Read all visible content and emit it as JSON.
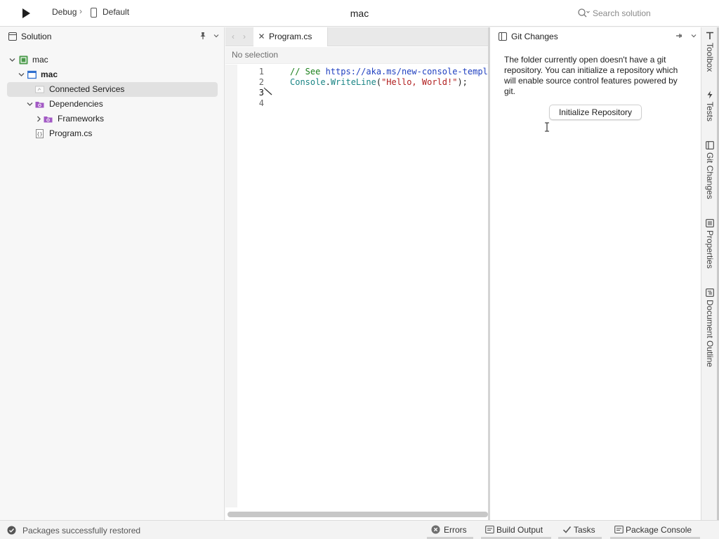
{
  "toolbar": {
    "run_icon": "play-icon",
    "configuration": "Debug",
    "separator": "›",
    "device": "Default",
    "window_title": "mac",
    "search_placeholder": "Search solution"
  },
  "solution_panel": {
    "title": "Solution",
    "tree": [
      {
        "label": "mac",
        "kind": "solution",
        "expanded": true
      },
      {
        "label": "mac",
        "kind": "project",
        "expanded": true
      },
      {
        "label": "Connected Services",
        "kind": "folder",
        "selected": true
      },
      {
        "label": "Dependencies",
        "kind": "dependencies",
        "expanded": true
      },
      {
        "label": "Frameworks",
        "kind": "frameworks",
        "expanded": false
      },
      {
        "label": "Program.cs",
        "kind": "csharp-file"
      }
    ]
  },
  "editor": {
    "tab_label": "Program.cs",
    "path_text": "No selection",
    "line_numbers": [
      "1",
      "2",
      "3",
      "4"
    ],
    "lines": [
      {
        "comment": "// See ",
        "link": "https://aka.ms/new-console-template"
      },
      {
        "type": "Console",
        "dot": ".",
        "method": "WriteLine",
        "open": "(",
        "string": "\"Hello, World!\"",
        "close": ");"
      }
    ]
  },
  "git_panel": {
    "title": "Git Changes",
    "message": "The folder currently open doesn't have a git repository. You can initialize a repository which will enable source control features powered by git.",
    "button_label": "Initialize Repository"
  },
  "side_pads": [
    "Toolbox",
    "Tests",
    "Git Changes",
    "Properties",
    "Document Outline"
  ],
  "statusbar": {
    "message": "Packages successfully restored",
    "buttons": [
      "Errors",
      "Build Output",
      "Tasks",
      "Package Console"
    ]
  },
  "colors": {
    "selection": "#e1e1e1",
    "comment": "#1a7f1a",
    "link": "#2040c0",
    "type": "#1a8585",
    "string": "#b22020"
  }
}
